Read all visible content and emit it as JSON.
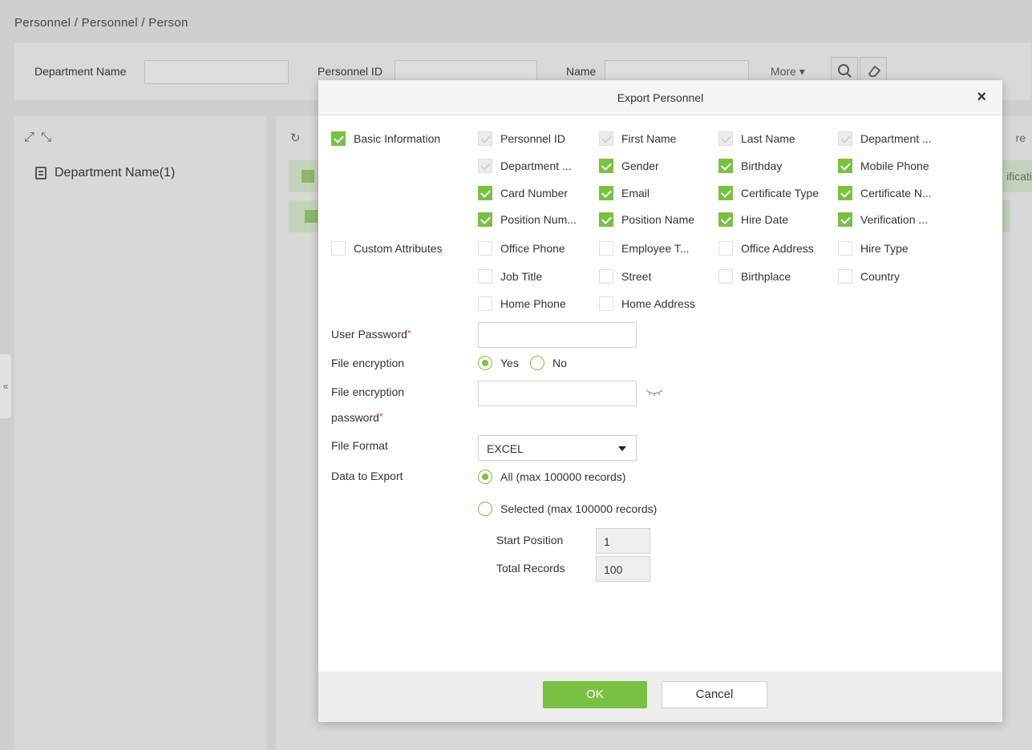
{
  "breadcrumb": "Personnel / Personnel / Person",
  "search": {
    "department_label": "Department Name",
    "personnel_id_label": "Personnel ID",
    "name_label": "Name",
    "more_label": "More"
  },
  "tree": {
    "item": "Department Name(1)"
  },
  "grid": {
    "right_header": "re",
    "right_cell": "ificati"
  },
  "modal": {
    "title": "Export Personnel",
    "close": "×",
    "basic": {
      "label": "Basic Information",
      "fields": [
        "Personnel ID",
        "First Name",
        "Last Name",
        "Department ...",
        "Department ...",
        "Gender",
        "Birthday",
        "Mobile Phone",
        "Card Number",
        "Email",
        "Certificate Type",
        "Certificate N...",
        "Position Num...",
        "Position Name",
        "Hire Date",
        "Verification ..."
      ]
    },
    "custom": {
      "label": "Custom Attributes",
      "fields": [
        "Office Phone",
        "Employee T...",
        "Office Address",
        "Hire Type",
        "Job Title",
        "Street",
        "Birthplace",
        "Country",
        "Home Phone",
        "Home Address"
      ]
    },
    "user_password_label": "User Password",
    "required_mark": "*",
    "file_encryption_label": "File encryption",
    "yes_label": "Yes",
    "no_label": "No",
    "file_encryption_password_label_1": "File encryption",
    "file_encryption_password_label_2": "password",
    "file_format_label": "File Format",
    "file_format_value": "EXCEL",
    "data_to_export_label": "Data to Export",
    "all_option": "All (max 100000 records)",
    "selected_option": "Selected (max 100000 records)",
    "start_position_label": "Start Position",
    "start_position_value": "1",
    "total_records_label": "Total Records",
    "total_records_value": "100",
    "ok_label": "OK",
    "cancel_label": "Cancel"
  }
}
